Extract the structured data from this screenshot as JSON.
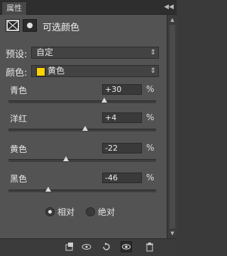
{
  "panel_tab": "属性",
  "header": {
    "title": "可选颜色"
  },
  "preset": {
    "label": "预设:",
    "value": "自定"
  },
  "colors": {
    "label": "颜色:",
    "value": "黄色",
    "swatch_color": "#ffd400"
  },
  "sliders": [
    {
      "name": "青色",
      "value": "+30",
      "unit": "%",
      "percent": 30
    },
    {
      "name": "洋红",
      "value": "+4",
      "unit": "%",
      "percent": 4
    },
    {
      "name": "黄色",
      "value": "-22",
      "unit": "%",
      "percent": -22
    },
    {
      "name": "黑色",
      "value": "-46",
      "unit": "%",
      "percent": -46
    }
  ],
  "method": {
    "options": [
      "相对",
      "绝对"
    ],
    "selected": "相对"
  },
  "icons": {
    "collapse": "collapse-arrows-icon",
    "clip_to_layer": "clip-to-layer-icon",
    "view_previous": "view-previous-state-icon",
    "reset": "reset-icon",
    "visibility": "eye-icon",
    "delete": "trash-icon"
  }
}
